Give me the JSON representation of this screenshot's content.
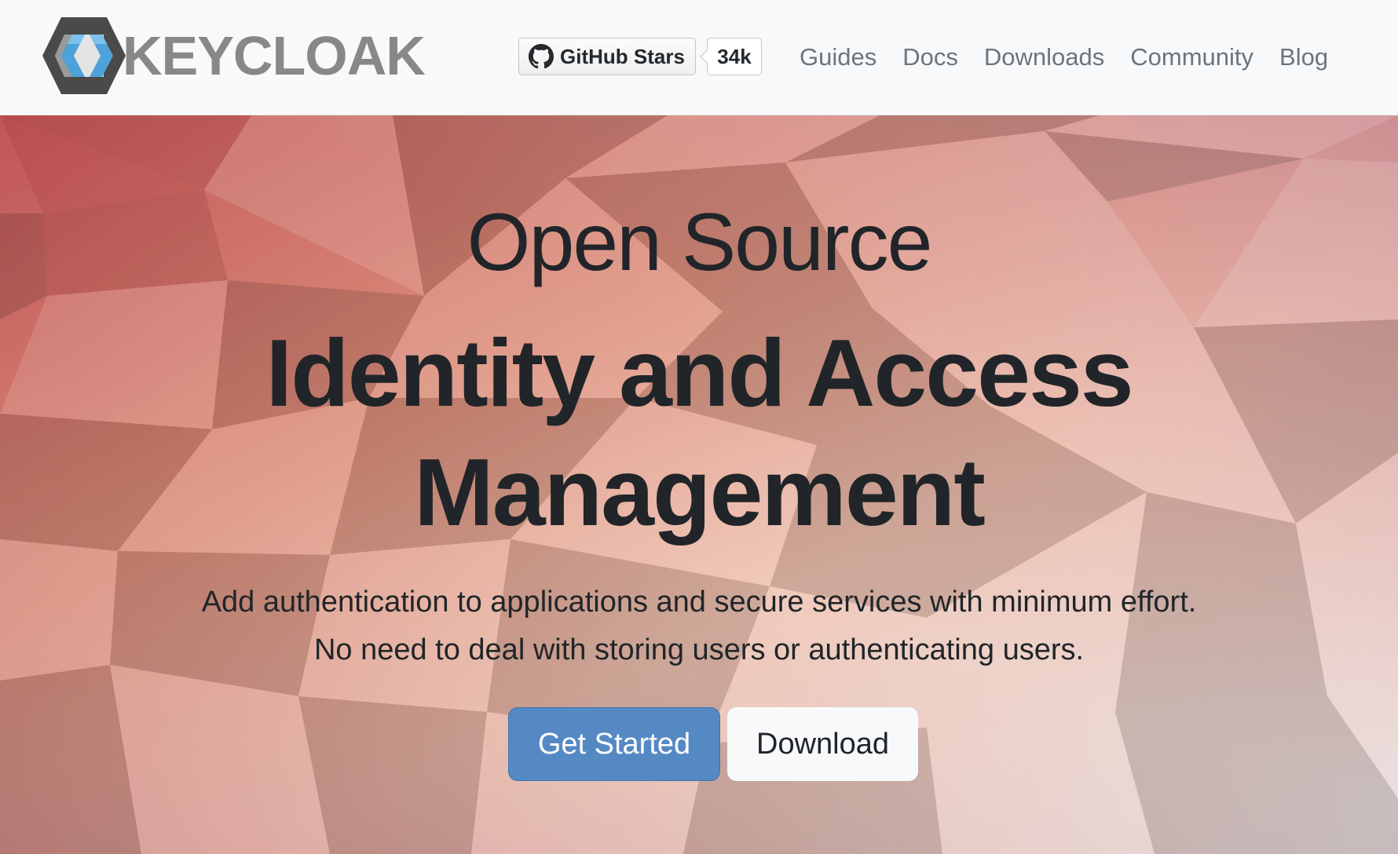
{
  "header": {
    "logo_text": "KEYCLOAK",
    "github": {
      "label": "GitHub Stars",
      "count": "34k"
    },
    "nav": [
      {
        "label": "Guides"
      },
      {
        "label": "Docs"
      },
      {
        "label": "Downloads"
      },
      {
        "label": "Community"
      },
      {
        "label": "Blog"
      }
    ]
  },
  "hero": {
    "pre_title": "Open Source",
    "title_line1": "Identity and Access",
    "title_line2": "Management",
    "subtitle_line1": "Add authentication to applications and secure services with minimum effort.",
    "subtitle_line2": "No need to deal with storing users or authenticating users.",
    "primary_button": "Get Started",
    "secondary_button": "Download"
  },
  "colors": {
    "primary_button": "#5589c4",
    "nav_text": "#6c757d",
    "heading_text": "#212529",
    "logo_dark": "#4a4a4a",
    "logo_blue": "#4da3d9"
  },
  "icons": {
    "logo": "keycloak-logo-icon",
    "github": "github-icon"
  }
}
